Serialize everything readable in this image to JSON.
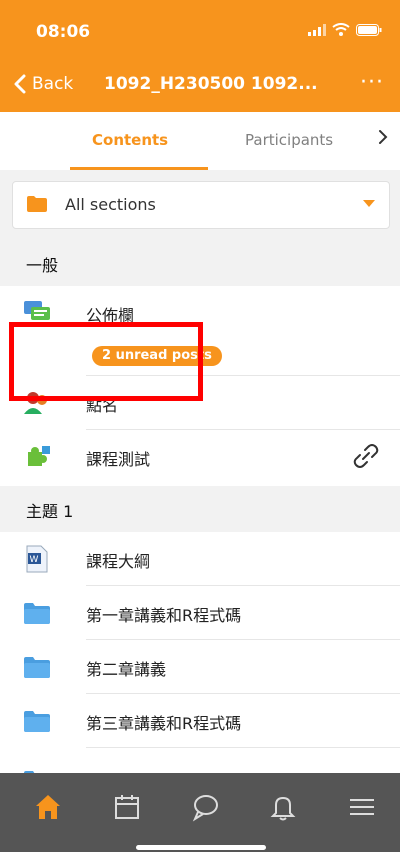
{
  "status_bar": {
    "time": "08:06"
  },
  "navbar": {
    "back_label": "Back",
    "title": "1092_H230500 1092...",
    "more_label": "···"
  },
  "tabs": [
    {
      "label": "Contents",
      "active": true
    },
    {
      "label": "Participants",
      "active": false
    }
  ],
  "filter": {
    "label": "All sections"
  },
  "sections": [
    {
      "title": "一般",
      "items": [
        {
          "label": "公佈欄",
          "icon": "forum-icon"
        },
        {
          "label": "點名",
          "icon": "attendance-icon"
        },
        {
          "label": "課程測試",
          "icon": "puzzle-icon",
          "action_icon": "link-icon"
        }
      ]
    },
    {
      "title": "主題 1",
      "items": [
        {
          "label": "課程大綱",
          "icon": "word-doc-icon"
        },
        {
          "label": "第一章講義和R程式碼",
          "icon": "folder-icon"
        },
        {
          "label": "第二章講義",
          "icon": "folder-icon"
        },
        {
          "label": "第三章講義和R程式碼",
          "icon": "folder-icon"
        }
      ]
    }
  ],
  "badge": {
    "label": "2 unread posts"
  },
  "bottom_tabs": [
    {
      "icon": "home-icon",
      "active": true
    },
    {
      "icon": "calendar-icon",
      "active": false
    },
    {
      "icon": "chat-icon",
      "active": false
    },
    {
      "icon": "bell-icon",
      "active": false
    },
    {
      "icon": "menu-icon",
      "active": false
    }
  ],
  "colors": {
    "accent": "#f7941d",
    "highlight": "#ff0000",
    "tabbar_bg": "#555555"
  }
}
